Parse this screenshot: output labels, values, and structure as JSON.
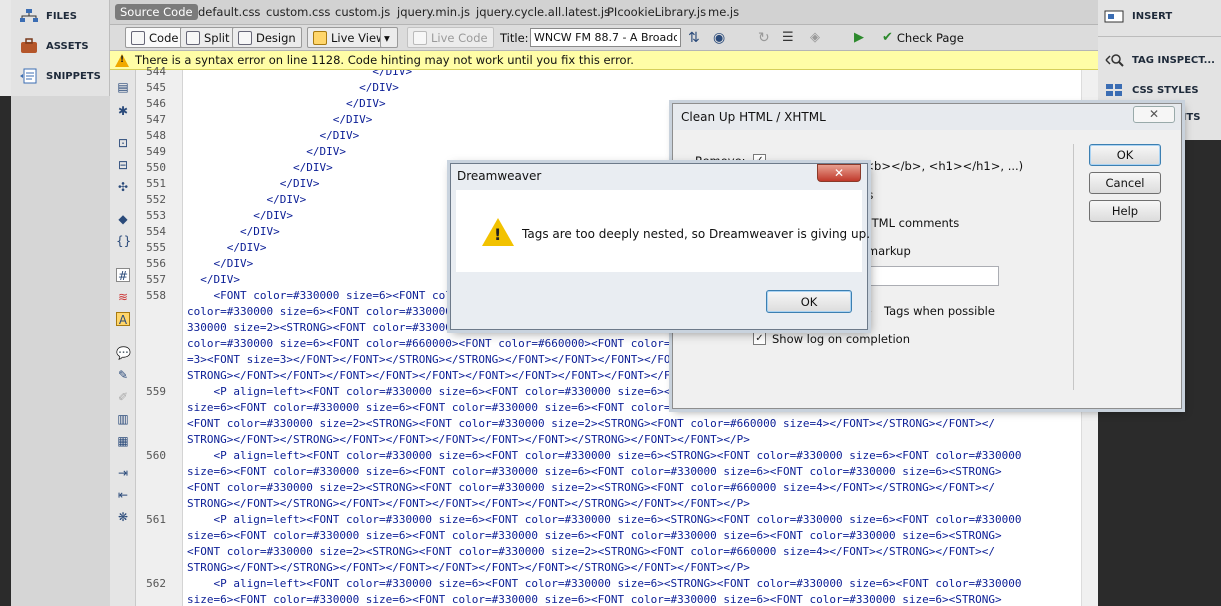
{
  "files_panel": {
    "items": [
      {
        "label": "FILES",
        "icon": "files-tree-icon"
      },
      {
        "label": "ASSETS",
        "icon": "assets-briefcase-icon"
      },
      {
        "label": "SNIPPETS",
        "icon": "snippets-icon"
      }
    ]
  },
  "doc_tabs": {
    "source_code": "Source Code",
    "files": [
      "default.css",
      "custom.css",
      "custom.js",
      "jquery.min.js",
      "jquery.cycle.all.latest.js",
      "PIcookieLibrary.js",
      "me.js"
    ]
  },
  "toolbar": {
    "code": "Code",
    "split": "Split",
    "design": "Design",
    "live_view": "Live View",
    "live_code": "Live Code",
    "title_label": "Title:",
    "title_value": "WNCW FM 88.7 - A Broadcast",
    "check_page": "Check Page"
  },
  "warning_bar": {
    "text": "There is a syntax error on line 1128.  Code hinting may not work until you fix this error."
  },
  "gutter": {
    "line_numbers": [
      "544",
      "545",
      "546",
      "547",
      "548",
      "549",
      "550",
      "551",
      "552",
      "553",
      "554",
      "555",
      "556",
      "557",
      "558",
      "",
      "",
      "",
      "",
      "",
      "559",
      "",
      "",
      "",
      "560",
      "",
      "",
      "",
      "561",
      "",
      "",
      "",
      "562",
      ""
    ]
  },
  "code": {
    "lines": [
      "                            </DIV>",
      "                          </DIV>",
      "                        </DIV>",
      "                      </DIV>",
      "                    </DIV>",
      "                  </DIV>",
      "                </DIV>",
      "              </DIV>",
      "            </DIV>",
      "          </DIV>",
      "        </DIV>",
      "      </DIV>",
      "    </DIV>",
      "  </DIV>",
      "    <FONT color=#330000 size=6><FONT color=#330000 size=6><FONT color=#330000 size=6><FONT color=#330000 size=6><STRONG><FONT color=#330000 size=6><FONT",
      "color=#330000 size=6><FONT color=#330000 size=6><FONT color=#330000 size=6><FONT color=#330000 size=6><FONT color=#330000 size=6><FONT color=#",
      "330000 size=2><STRONG><FONT color=#330000 size=2><STRONG><FONT color=#330000 size=2><STRONG><FONT color=#330000 size=6><FONT color=#330000",
      "color=#330000 size=6><FONT color=#660000><FONT color=#660000><FONT color=#660000 size=4><FONT color=#660000 size=4><FONT color=#660000 size",
      "=3><FONT size=3></FONT></FONT></STRONG></STRONG></FONT></FONT></FONT></FONT></FONT></FONT></FONT></FONT></FONT>",
      "STRONG></FONT></FONT></FONT></FONT></FONT></FONT></FONT></FONT></FONT></FONT></FONT></FONT></STRONG></FONT></FONT>",
      "    <P align=left><FONT color=#330000 size=6><FONT color=#330000 size=6><FONT color=#330000 size=6><STRONG><FONT color=#330000 size=6><FONT color=#330000",
      "size=6><FONT color=#330000 size=6><FONT color=#330000 size=6><FONT color=#330000 size=6><FONT color=#330000 size=6><FONT color=#330000 size=6><STRONG>",
      "<FONT color=#330000 size=2><STRONG><FONT color=#330000 size=2><STRONG><FONT color=#660000 size=4></FONT></STRONG></FONT></",
      "STRONG></FONT></STRONG></FONT></FONT></FONT></FONT></FONT></STRONG></FONT></FONT></P>",
      "    <P align=left><FONT color=#330000 size=6><FONT color=#330000 size=6><STRONG><FONT color=#330000 size=6><FONT color=#330000",
      "size=6><FONT color=#330000 size=6><FONT color=#330000 size=6><FONT color=#330000 size=6><FONT color=#330000 size=6><STRONG>",
      "<FONT color=#330000 size=2><STRONG><FONT color=#330000 size=2><STRONG><FONT color=#660000 size=4></FONT></STRONG></FONT></",
      "STRONG></FONT></STRONG></FONT></FONT></FONT></FONT></FONT></STRONG></FONT></FONT></P>",
      "    <P align=left><FONT color=#330000 size=6><FONT color=#330000 size=6><STRONG><FONT color=#330000 size=6><FONT color=#330000",
      "size=6><FONT color=#330000 size=6><FONT color=#330000 size=6><FONT color=#330000 size=6><FONT color=#330000 size=6><STRONG>",
      "<FONT color=#330000 size=2><STRONG><FONT color=#330000 size=2><STRONG><FONT color=#660000 size=4></FONT></STRONG></FONT></",
      "STRONG></FONT></STRONG></FONT></FONT></FONT></FONT></FONT></STRONG></FONT></FONT></P>",
      "    <P align=left><FONT color=#330000 size=6><FONT color=#330000 size=6><STRONG><FONT color=#330000 size=6><FONT color=#330000",
      "size=6><FONT color=#330000 size=6><FONT color=#330000 size=6><FONT color=#330000 size=6><FONT color=#330000 size=6><STRONG>"
    ]
  },
  "right_panel": {
    "insert": "INSERT",
    "tag_inspector": "TAG INSPECT...",
    "css_styles": "CSS STYLES",
    "partial": "NTS"
  },
  "cleanup_dialog": {
    "title": "Clean Up HTML / XHTML",
    "remove_label": "Remove:",
    "opt_empty_tags": "ns (<b></b>, <h1></h1>, ...)",
    "opt_nested_tags": "ags",
    "opt_html_comments": "HTML comments",
    "opt_special_markup": "al markup",
    "opt_combine_font": "Tags when possible",
    "show_log": "Show log on completion",
    "ok": "OK",
    "cancel": "Cancel",
    "help": "Help"
  },
  "alert_dialog": {
    "title": "Dreamweaver",
    "message": "Tags are too deeply nested, so Dreamweaver is giving up.",
    "ok": "OK",
    "close": "✕"
  },
  "colors": {
    "code_text": "#0b1e96",
    "warning_bar": "#fffda6",
    "close_button": "#c0392b"
  }
}
